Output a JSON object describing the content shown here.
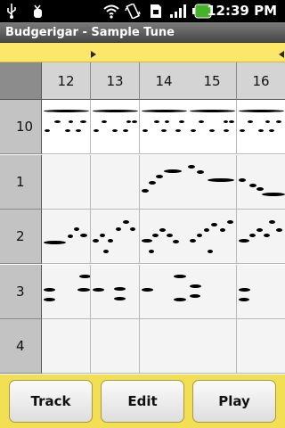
{
  "status_bar": {
    "time": "12:39 PM",
    "icons": [
      "usb-icon",
      "debug-icon",
      "wifi-icon",
      "vibrate-icon",
      "sd-card-icon",
      "signal-icon",
      "battery-icon"
    ]
  },
  "app": {
    "title": "Budgerigar - Sample Tune"
  },
  "grid": {
    "columns": [
      "12",
      "13",
      "14",
      "15",
      "16"
    ],
    "tracks": [
      "10",
      "1",
      "2",
      "3",
      "4"
    ]
  },
  "buttons": {
    "track": "Track",
    "edit": "Edit",
    "play": "Play"
  },
  "colors": {
    "accent": "#fbe25a",
    "note": "#000000",
    "header": "#c3c3c3"
  }
}
